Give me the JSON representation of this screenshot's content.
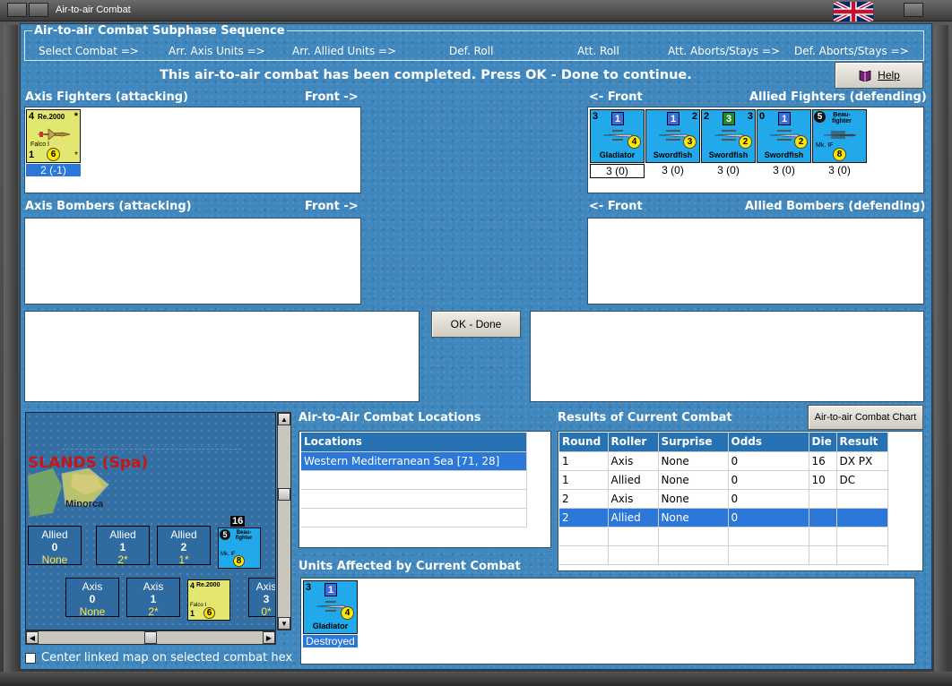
{
  "window": {
    "title": "Air-to-air Combat"
  },
  "subphase": {
    "title": "Air-to-air Combat Subphase Sequence",
    "items": [
      "Select Combat =>",
      "Arr. Axis Units =>",
      "Arr. Allied Units =>",
      "Def. Roll",
      "Att. Roll",
      "Att. Aborts/Stays =>",
      "Def. Aborts/Stays =>"
    ]
  },
  "status_message": "This air-to-air combat has been completed.  Press OK - Done to continue.",
  "help_button": "Help",
  "sections": {
    "axis_fighters": "Axis Fighters (attacking)",
    "axis_fighters_front": "Front ->",
    "allied_fighters_front": "<- Front",
    "allied_fighters": "Allied Fighters (defending)",
    "axis_bombers": "Axis Bombers (attacking)",
    "axis_bombers_front": "Front ->",
    "allied_bombers_front": "<- Front",
    "allied_bombers": "Allied Bombers (defending)"
  },
  "axis_fighter_units": [
    {
      "top_left": "4",
      "name_top": "Re.2000",
      "corner": "*",
      "sub": "Falco I",
      "bottom_left": "1",
      "rating": "6",
      "caption": "2 (-1)"
    }
  ],
  "allied_fighter_units": [
    {
      "top_left": "3",
      "box": "1",
      "top_right": "",
      "name": "Gladiator",
      "rating": "4",
      "caption": "3 (0)"
    },
    {
      "top_left": "",
      "box": "1",
      "top_right": "2",
      "name": "Swordfish",
      "rating": "3",
      "caption": "3 (0)"
    },
    {
      "top_left": "2",
      "box": "3",
      "top_right": "3",
      "name": "Swordfish",
      "rating": "2",
      "caption": "3 (0)"
    },
    {
      "top_left": "0",
      "box": "1",
      "top_right": "",
      "name": "Swordfish",
      "rating": "2",
      "caption": "3 (0)"
    },
    {
      "top_left": "5",
      "box": "",
      "top_right": "",
      "name_top": "Beau-fighter",
      "sub": "Mk. IF",
      "name": "",
      "rating": "8",
      "caption": "3 (0)"
    }
  ],
  "ok_button": "OK - Done",
  "map": {
    "region_label": "SLANDS (Spa)",
    "island_label": "Minorca",
    "stack_count": "16",
    "allied_boxes": [
      {
        "side": "Allied",
        "num": "0",
        "note": "None"
      },
      {
        "side": "Allied",
        "num": "1",
        "note": "2*"
      },
      {
        "side": "Allied",
        "num": "2",
        "note": "1*"
      }
    ],
    "axis_boxes": [
      {
        "side": "Axis",
        "num": "0",
        "note": "None"
      },
      {
        "side": "Axis",
        "num": "1",
        "note": "2*"
      },
      {
        "side": "Axis",
        "num": "3",
        "note": "0*"
      }
    ],
    "map_beau": {
      "top_left": "5",
      "name_top": "Beau-fighter",
      "sub": "Mk. IF",
      "rating": "8"
    },
    "map_re2000": {
      "top_left": "4",
      "name_top": "Re.2000",
      "sub": "Falco I",
      "bottom_left": "1",
      "rating": "6"
    }
  },
  "center_map_checkbox": "Center linked map on selected combat hex",
  "locations": {
    "title": "Air-to-Air Combat Locations",
    "header": "Locations",
    "rows": [
      "Western Mediterranean Sea [71, 28]"
    ]
  },
  "results": {
    "title": "Results of Current Combat",
    "chart_button": "Air-to-air Combat Chart",
    "headers": [
      "Round",
      "Roller",
      "Surprise",
      "Odds",
      "Die",
      "Result"
    ],
    "rows": [
      [
        "1",
        "Axis",
        "None",
        "0",
        "16",
        "DX PX"
      ],
      [
        "1",
        "Allied",
        "None",
        "0",
        "10",
        "DC"
      ],
      [
        "2",
        "Axis",
        "None",
        "0",
        "",
        ""
      ],
      [
        "2",
        "Allied",
        "None",
        "0",
        "",
        ""
      ]
    ]
  },
  "affected": {
    "title": "Units Affected by Current Combat",
    "unit": {
      "top_left": "3",
      "box": "1",
      "name": "Gladiator",
      "rating": "4",
      "caption": "Destroyed"
    }
  },
  "colors": {
    "background": "#3f87bc",
    "allied_counter": "#21a9ec",
    "axis_counter": "#e4e76f",
    "selection": "#2b78d8"
  }
}
